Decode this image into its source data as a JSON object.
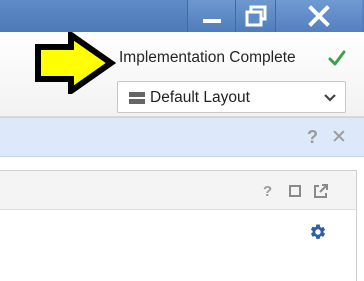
{
  "window": {
    "minimize_icon": "minimize-icon",
    "restore_icon": "restore-icon",
    "close_icon": "close-icon"
  },
  "status": {
    "text": "Implementation Complete",
    "icon": "checkmark-icon",
    "color": "#3aa34a"
  },
  "layout_select": {
    "value": "Default Layout",
    "icon": "layout-icon"
  },
  "info_bar": {
    "help_label": "?",
    "close_label": "✕"
  },
  "panel": {
    "help_label": "?",
    "settings_icon": "gear-icon"
  },
  "annotation": {
    "arrow_color": "#ffff00"
  }
}
